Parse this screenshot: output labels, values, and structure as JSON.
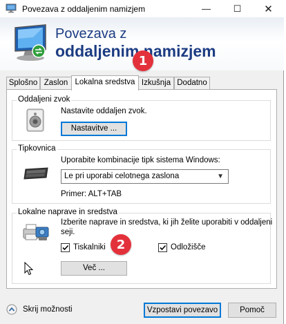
{
  "window": {
    "title": "Povezava z oddaljenim namizjem",
    "controls": {
      "minimize": "—",
      "maximize": "☐",
      "close": "✕"
    }
  },
  "header": {
    "line1": "Povezava z",
    "line2": "oddaljenim namizjem"
  },
  "tabs": [
    {
      "label": "Splošno"
    },
    {
      "label": "Zaslon"
    },
    {
      "label": "Lokalna sredstva"
    },
    {
      "label": "Izkušnja"
    },
    {
      "label": "Dodatno"
    }
  ],
  "sections": {
    "audio": {
      "title": "Oddaljeni zvok",
      "description": "Nastavite oddaljen zvok.",
      "button": "Nastavitve ..."
    },
    "keyboard": {
      "title": "Tipkovnica",
      "description": "Uporabite kombinacije tipk sistema Windows:",
      "selected": "Le pri uporabi celotnega zaslona",
      "example": "Primer: ALT+TAB"
    },
    "devices": {
      "title": "Lokalne naprave in sredstva",
      "description_line1": "Izberite naprave in sredstva, ki jih želite uporabiti v oddaljeni",
      "description_line2": "seji.",
      "printers_label": "Tiskalniki",
      "printers_checked": true,
      "clipboard_label": "Odložišče",
      "clipboard_checked": true,
      "more_button": "Več ..."
    }
  },
  "badges": [
    "1",
    "2"
  ],
  "footer": {
    "toggle_label": "Skrij možnosti",
    "connect_button": "Vzpostavi povezavo",
    "help_button": "Pomoč"
  },
  "colors": {
    "accent": "#0078d7",
    "header_text": "#1c3c82",
    "badge": "#e3313b"
  }
}
